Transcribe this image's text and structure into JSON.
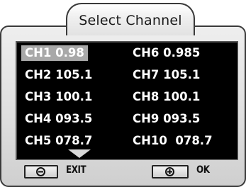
{
  "title": "Select Channel",
  "channels_left": [
    {
      "label": "CH1 0.98",
      "selected": true
    },
    {
      "label": "CH2 105.1",
      "selected": false
    },
    {
      "label": "CH3 100.1",
      "selected": false
    },
    {
      "label": "CH4 093.5",
      "selected": false
    },
    {
      "label": "CH5 078.7",
      "selected": false
    }
  ],
  "channels_right": [
    {
      "label": "CH6 0.985",
      "selected": false
    },
    {
      "label": "CH7 105.1",
      "selected": false
    },
    {
      "label": "CH8 100.1",
      "selected": false
    },
    {
      "label": "CH9 093.5",
      "selected": false
    },
    {
      "label": "CH10  078.7",
      "selected": false
    }
  ],
  "buttons": {
    "exit": {
      "icon_glyph": "⊖",
      "icon": "minus-icon",
      "label": "EXIT"
    },
    "ok": {
      "icon_glyph": "+",
      "icon": "plus-icon",
      "label": "OK"
    }
  },
  "scroll_indicator": {
    "icon": "scroll-down-arrow-icon"
  },
  "colors": {
    "list_background": "#000000",
    "text": "#ffffff",
    "selection": "#a8a8a8"
  }
}
